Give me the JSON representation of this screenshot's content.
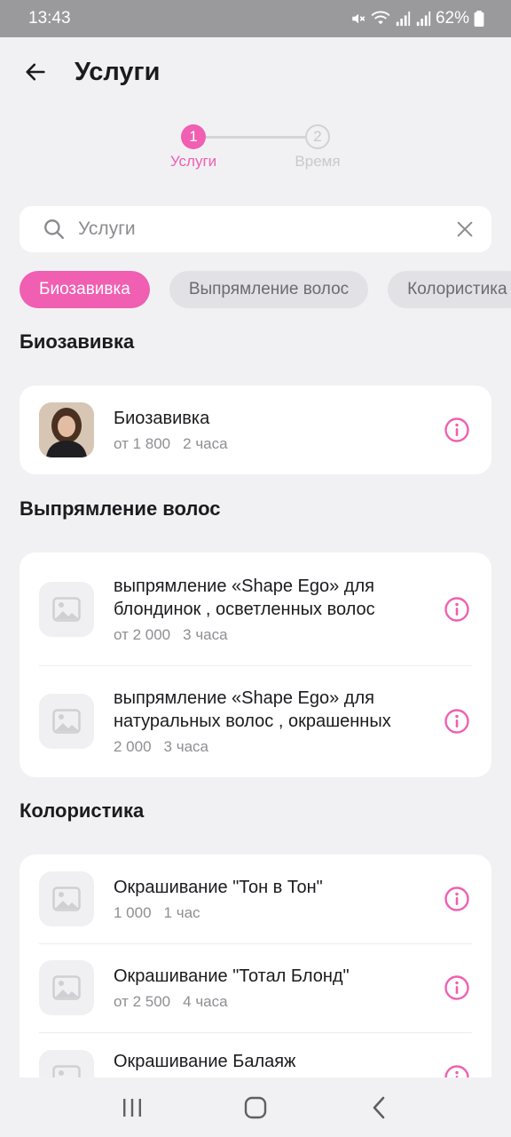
{
  "status_bar": {
    "time": "13:43",
    "battery": "62%"
  },
  "header": {
    "title": "Услуги"
  },
  "stepper": [
    {
      "number": "1",
      "label": "Услуги",
      "active": true
    },
    {
      "number": "2",
      "label": "Время",
      "active": false
    }
  ],
  "search": {
    "placeholder": "Услуги",
    "value": ""
  },
  "categories": [
    "Биозавивка",
    "Выпрямление волос",
    "Колористика"
  ],
  "sections": [
    {
      "title": "Биозавивка",
      "items": [
        {
          "name": "Биозавивка",
          "price": "от 1 800",
          "duration": "2 часа"
        }
      ]
    },
    {
      "title": "Выпрямление волос",
      "items": [
        {
          "name": "выпрямление «Shape Ego» для блондинок , осветленных волос",
          "price": "от 2 000",
          "duration": "3 часа"
        },
        {
          "name": "выпрямление «Shape Ego» для натуральных волос , окрашенных",
          "price": "2 000",
          "duration": "3 часа"
        }
      ]
    },
    {
      "title": "Колористика",
      "items": [
        {
          "name": "Окрашивание \"Тон в Тон\"",
          "price": "1 000",
          "duration": "1 час"
        },
        {
          "name": "Окрашивание \"Тотал Блонд\"",
          "price": "от 2 500",
          "duration": "4 часа"
        },
        {
          "name": "Окрашивание Балаяж",
          "price": "",
          "duration": ""
        }
      ]
    }
  ],
  "colors": {
    "accent": "#f05fb1",
    "background": "#f1f1f4"
  },
  "icons": [
    "back-arrow-icon",
    "search-icon",
    "close-icon",
    "info-icon",
    "image-placeholder-icon",
    "recents-icon",
    "home-icon",
    "nav-back-icon"
  ]
}
